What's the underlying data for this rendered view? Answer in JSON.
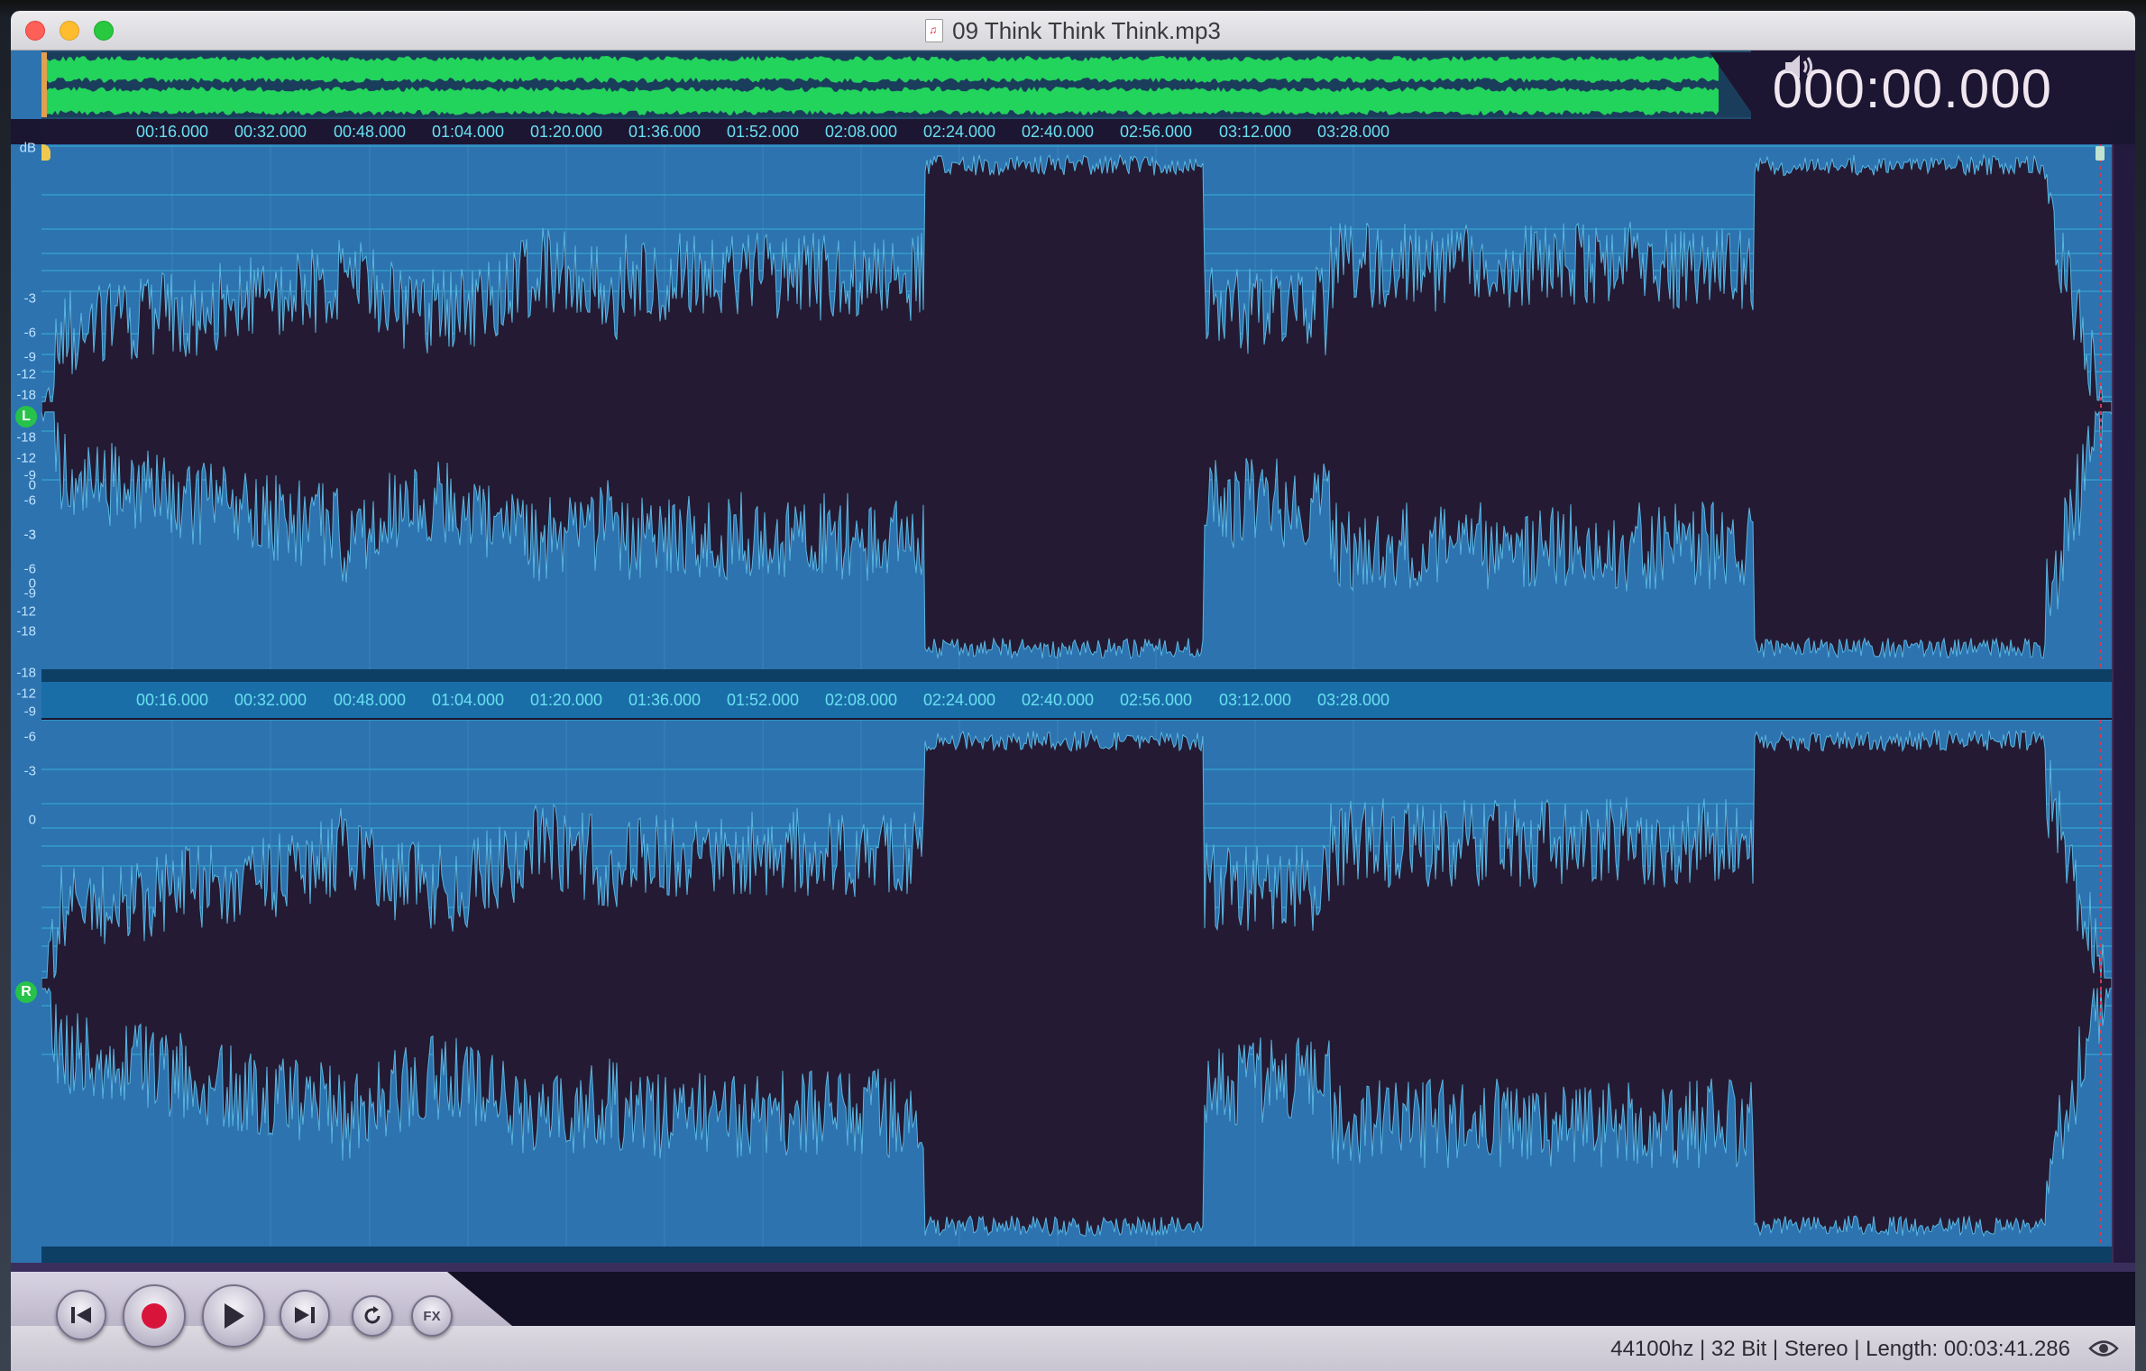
{
  "window": {
    "title": "09 Think Think Think.mp3"
  },
  "time_display": "000:00.000",
  "timeline": {
    "labels": [
      "00:16.000",
      "00:32.000",
      "00:48.000",
      "01:04.000",
      "01:20.000",
      "01:36.000",
      "01:52.000",
      "02:08.000",
      "02:24.000",
      "02:40.000",
      "02:56.000",
      "03:12.000",
      "03:28.000"
    ]
  },
  "channels": [
    {
      "name": "L",
      "scale_unit": "dB",
      "db_labels": [
        "-3",
        "-6",
        "-9",
        "-12",
        "-18",
        "-18",
        "-12",
        "-9",
        "-6",
        "-3",
        "0"
      ]
    },
    {
      "name": "R",
      "scale_unit": "",
      "db_labels": [
        "0",
        "-3",
        "-6",
        "-9",
        "-12",
        "-18",
        "-18",
        "-12",
        "-9",
        "-6",
        "-3",
        "0"
      ]
    }
  ],
  "transport": {
    "buttons": [
      "skip-back",
      "record",
      "play",
      "skip-forward",
      "loop",
      "effects"
    ],
    "fx_label": "FX"
  },
  "status": "44100hz | 32 Bit | Stereo | Length: 00:03:41.286",
  "colors": {
    "waveform_bg": "#2c73b0",
    "waveform_fill": "#251a33",
    "overview_wave": "#22d35c",
    "timeline_text": "#68e0f0",
    "record": "#d8143a",
    "channel_badge": "#27c24a"
  }
}
